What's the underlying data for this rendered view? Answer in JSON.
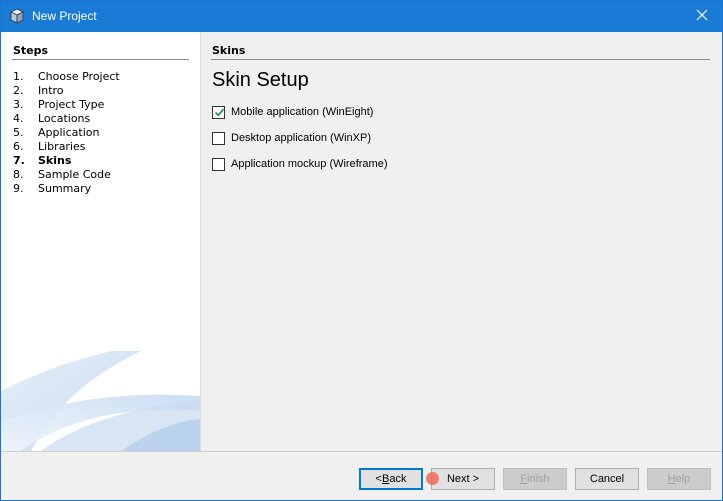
{
  "window": {
    "title": "New Project",
    "colors": {
      "titlebar": "#1a7bd6",
      "accent": "#0078d7",
      "cursor_marker": "#f26a55"
    }
  },
  "steps": {
    "heading": "Steps",
    "items": [
      {
        "num": "1.",
        "label": "Choose Project",
        "current": false
      },
      {
        "num": "2.",
        "label": "Intro",
        "current": false
      },
      {
        "num": "3.",
        "label": "Project Type",
        "current": false
      },
      {
        "num": "4.",
        "label": "Locations",
        "current": false
      },
      {
        "num": "5.",
        "label": "Application",
        "current": false
      },
      {
        "num": "6.",
        "label": "Libraries",
        "current": false
      },
      {
        "num": "7.",
        "label": "Skins",
        "current": true
      },
      {
        "num": "8.",
        "label": "Sample Code",
        "current": false
      },
      {
        "num": "9.",
        "label": "Summary",
        "current": false
      }
    ]
  },
  "content": {
    "heading": "Skins",
    "title": "Skin Setup",
    "options": [
      {
        "label": "Mobile application (WinEight)",
        "checked": true
      },
      {
        "label": "Desktop application (WinXP)",
        "checked": false
      },
      {
        "label": "Application mockup (Wireframe)",
        "checked": false
      }
    ]
  },
  "buttons": {
    "back": {
      "mnemonic": "B",
      "rest": "ack",
      "prefix": "< ",
      "enabled": true,
      "focused": true
    },
    "next": {
      "label": "Next >",
      "enabled": true
    },
    "finish": {
      "mnemonic": "F",
      "rest": "inish",
      "enabled": false
    },
    "cancel": {
      "label": "Cancel",
      "enabled": true
    },
    "help": {
      "mnemonic": "H",
      "rest": "elp",
      "enabled": false
    }
  }
}
